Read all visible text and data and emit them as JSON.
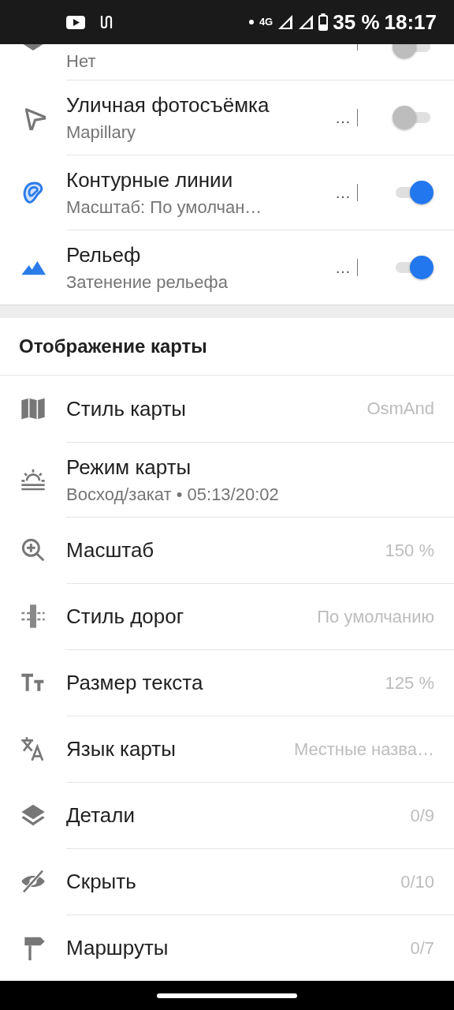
{
  "status_bar": {
    "network": "4G",
    "battery": "35 %",
    "time": "18:17"
  },
  "layers": [
    {
      "subtitle": "Нет",
      "on": false
    },
    {
      "title": "Уличная фотосъёмка",
      "subtitle": "Mapillary",
      "menu": "…",
      "on": false
    },
    {
      "title": "Контурные линии",
      "subtitle": "Масштаб: По умолчан…",
      "menu": "…",
      "on": true
    },
    {
      "title": "Рельеф",
      "subtitle": "Затенение рельефа",
      "menu": "…",
      "on": true
    }
  ],
  "section": {
    "title": "Отображение карты",
    "items": [
      {
        "title": "Стиль карты",
        "value": "OsmAnd"
      },
      {
        "title": "Режим карты",
        "subtitle": "Восход/закат • 05:13/20:02"
      },
      {
        "title": "Масштаб",
        "value": "150 %"
      },
      {
        "title": "Стиль дорог",
        "value": "По умолчанию"
      },
      {
        "title": "Размер текста",
        "value": "125 %"
      },
      {
        "title": "Язык карты",
        "value": "Местные назва…"
      },
      {
        "title": "Детали",
        "value": "0/9"
      },
      {
        "title": "Скрыть",
        "value": "0/10"
      },
      {
        "title": "Маршруты",
        "value": "0/7"
      }
    ]
  }
}
